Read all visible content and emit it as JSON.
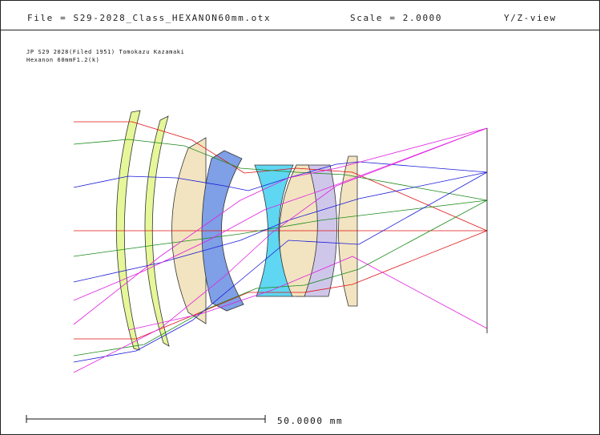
{
  "header": {
    "file_label": "File = S29-2028_Class_HEXANON60mm.otx",
    "scale_label": "Scale = 2.0000",
    "view_label": "Y/Z-view"
  },
  "notes": {
    "line1": "JP S29 2028(Filed 1951) Tomokazu Kazamaki",
    "line2": "Hexanon 60mmF1.2(k)"
  },
  "scale_bar": {
    "label": "50.0000 mm"
  },
  "colors": {
    "lens_green": "#e6f79a",
    "lens_tan": "#f2e4c0",
    "lens_blue": "#7f9fe6",
    "lens_cyan": "#5fd6f2",
    "lens_lavender": "#cfc7ea",
    "ray_red": "#e01010",
    "ray_green": "#1a8a1a",
    "ray_blue": "#1a1ad8",
    "ray_magenta": "#e020e0"
  }
}
